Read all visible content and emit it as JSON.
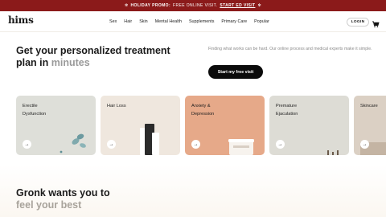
{
  "promo": {
    "prefix": "HOLIDAY PROMO:",
    "text": "FREE ONLINE VISIT.",
    "cta": "START ED VISIT"
  },
  "nav": {
    "logo": "hims",
    "links": [
      "Sex",
      "Hair",
      "Skin",
      "Mental Health",
      "Supplements",
      "Primary Care",
      "Popular"
    ],
    "login": "LOGIN"
  },
  "hero": {
    "headline_main": "Get your personalized treatment plan in",
    "headline_muted": "minutes",
    "subcopy": "Finding what works can be hard. Our online process and medical experts make it simple.",
    "cta": "Start my free visit"
  },
  "cards": [
    {
      "label": "Erectile\nDysfunction",
      "bg": "#dedfd9"
    },
    {
      "label": "Hair Loss",
      "bg": "#efe7de"
    },
    {
      "label": "Anxiety &\nDepression",
      "bg": "#e6a989"
    },
    {
      "label": "Premature\nEjaculation",
      "bg": "#dddcd5"
    },
    {
      "label": "Skincare",
      "bg": "#dbd0c4"
    }
  ],
  "section2": {
    "title": "Gronk wants you to",
    "subtitle": "feel your best"
  }
}
